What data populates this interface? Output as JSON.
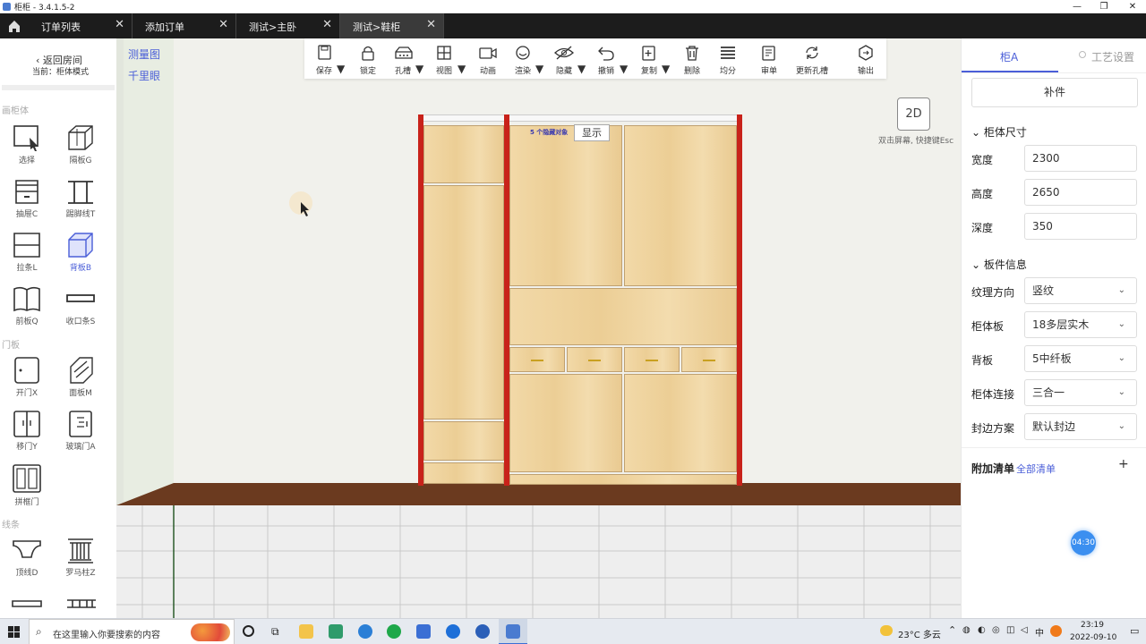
{
  "window": {
    "title": "柜柜 - 3.4.1.5-2",
    "controls": [
      "—",
      "❐",
      "✕"
    ]
  },
  "tabs": [
    {
      "label": "订单列表"
    },
    {
      "label": "添加订单"
    },
    {
      "label": "测试>主卧"
    },
    {
      "label": "测试>鞋柜",
      "active": true
    }
  ],
  "left": {
    "back": "返回房间",
    "current": "当前：柜体模式",
    "sections": [
      "画柜体",
      "门板",
      "线条"
    ],
    "tools": [
      {
        "label": "选择",
        "icon": "cursor-icon"
      },
      {
        "label": "隔板G",
        "icon": "cube-partition-icon"
      },
      {
        "label": "抽屉C",
        "icon": "drawer-icon"
      },
      {
        "label": "踢脚线T",
        "icon": "kickboard-icon"
      },
      {
        "label": "拉条L",
        "icon": "strip-icon"
      },
      {
        "label": "背板B",
        "icon": "back-panel-icon",
        "selected": true
      },
      {
        "label": "前板Q",
        "icon": "front-panel-icon"
      },
      {
        "label": "收口条S",
        "icon": "closing-strip-icon"
      },
      {
        "label": "开门X",
        "icon": "swing-door-icon"
      },
      {
        "label": "面板M",
        "icon": "face-panel-icon"
      },
      {
        "label": "移门Y",
        "icon": "sliding-door-icon"
      },
      {
        "label": "玻璃门A",
        "icon": "glass-door-icon"
      },
      {
        "label": "拼框门",
        "icon": "frame-door-icon"
      },
      {
        "label": "顶线D",
        "icon": "top-molding-icon"
      },
      {
        "label": "罗马柱Z",
        "icon": "roman-column-icon"
      }
    ]
  },
  "view_links": [
    "测量图",
    "千里眼"
  ],
  "toolbar": [
    {
      "label": "保存",
      "icon": "save-icon",
      "dropdown": true
    },
    {
      "label": "锁定",
      "icon": "lock-icon"
    },
    {
      "label": "孔槽",
      "icon": "hole-slot-icon",
      "dropdown": true
    },
    {
      "label": "视图",
      "icon": "view-grid-icon",
      "dropdown": true
    },
    {
      "label": "动画",
      "icon": "animation-icon"
    },
    {
      "label": "渲染",
      "icon": "render-icon",
      "dropdown": true
    },
    {
      "label": "隐藏",
      "icon": "hide-eye-icon",
      "dropdown": true
    },
    {
      "label": "撤销",
      "icon": "undo-icon",
      "dropdown": true
    },
    {
      "label": "复制",
      "icon": "copy-icon",
      "dropdown": true
    },
    {
      "label": "删除",
      "icon": "trash-icon"
    },
    {
      "label": "均分",
      "icon": "equal-divide-icon"
    },
    {
      "label": "审单",
      "icon": "review-icon"
    },
    {
      "label": "更新孔槽",
      "icon": "refresh-icon"
    },
    {
      "label": "输出",
      "icon": "export-icon"
    }
  ],
  "scene": {
    "mode_button": "2D",
    "hint": "双击屏幕, 快捷键Esc",
    "hidden_objects": "5 个隐藏对象",
    "show_button": "显示"
  },
  "right": {
    "tab_cabinet": "柜A",
    "tab_craft": "工艺设置",
    "add_part": "补件",
    "dim_group": "柜体尺寸",
    "dims": [
      {
        "label": "宽度",
        "value": "2300"
      },
      {
        "label": "高度",
        "value": "2650"
      },
      {
        "label": "深度",
        "value": "350"
      }
    ],
    "board_group": "板件信息",
    "boards": [
      {
        "label": "纹理方向",
        "value": "竖纹"
      },
      {
        "label": "柜体板",
        "value": "18多层实木"
      },
      {
        "label": "背板",
        "value": "5中纤板"
      },
      {
        "label": "柜体连接",
        "value": "三合一"
      },
      {
        "label": "封边方案",
        "value": "默认封边"
      }
    ],
    "extra_label": "附加清单",
    "extra_link": "全部清单",
    "extra_add": "+",
    "timer": "04:30"
  },
  "taskbar": {
    "search_placeholder": "在这里输入你要搜索的内容",
    "weather": "23°C 多云",
    "time": "23:19",
    "date": "2022-09-10"
  }
}
